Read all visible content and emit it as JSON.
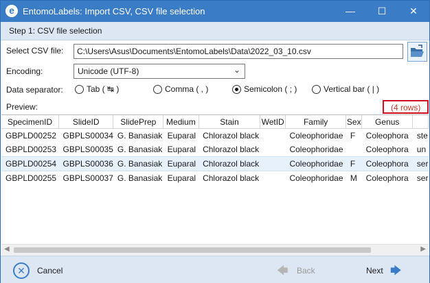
{
  "window": {
    "title": "EntomoLabels: Import CSV, CSV file selection",
    "icon_letter": "e",
    "minimize": "—",
    "maximize": "☐",
    "close": "✕"
  },
  "step": {
    "label": "Step 1: CSV file selection"
  },
  "form": {
    "file_label": "Select CSV file:",
    "file_path": "C:\\Users\\Asus\\Documents\\EntomoLabels\\Data\\2022_03_10.csv",
    "encoding_label": "Encoding:",
    "encoding_value": "Unicode (UTF-8)",
    "separator_label": "Data separator:",
    "separators": [
      {
        "label": "Tab ( ↹ )",
        "selected": false
      },
      {
        "label": "Comma ( , )",
        "selected": false
      },
      {
        "label": "Semicolon ( ; )",
        "selected": true
      },
      {
        "label": "Vertical bar ( | )",
        "selected": false
      }
    ]
  },
  "preview": {
    "label": "Preview:",
    "row_count": "(4 rows)",
    "columns": [
      "SpecimenID",
      "SlideID",
      "SlidePrep",
      "Medium",
      "Stain",
      "WetID",
      "Family",
      "Sex",
      "Genus",
      ""
    ],
    "rows": [
      [
        "GBPLD00252",
        "GBPLS00034",
        "G. Banasiak",
        "Euparal",
        "Chlorazol black",
        "",
        "Coleophoridae",
        "F",
        "Coleophora",
        "ste"
      ],
      [
        "GBPLD00253",
        "GBPLS00035",
        "G. Banasiak",
        "Euparal",
        "Chlorazol black",
        "",
        "Coleophoridae",
        "",
        "Coleophora",
        "un"
      ],
      [
        "GBPLD00254",
        "GBPLS00036",
        "G. Banasiak",
        "Euparal",
        "Chlorazol black",
        "",
        "Coleophoridae",
        "F",
        "Coleophora",
        "ser"
      ],
      [
        "GBPLD00255",
        "GBPLS00037",
        "G. Banasiak",
        "Euparal",
        "Chlorazol black",
        "",
        "Coleophoridae",
        "M",
        "Coleophora",
        "ser"
      ]
    ],
    "selected_row": 2
  },
  "footer": {
    "cancel": "Cancel",
    "back": "Back",
    "next": "Next",
    "back_arrow": "🡄",
    "next_arrow": "🡆"
  },
  "colors": {
    "accent": "#3a7cc6",
    "highlight": "#d10f1f"
  }
}
